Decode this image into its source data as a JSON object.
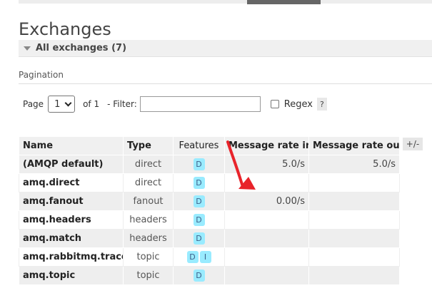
{
  "page": {
    "title": "Exchanges",
    "section_label": "All exchanges (7)"
  },
  "pagination": {
    "label": "Pagination",
    "page_label": "Page",
    "page_value": "1",
    "of_label": "of 1",
    "filter_label": "- Filter:",
    "filter_value": "",
    "regex_label": "Regex",
    "regex_checked": false,
    "help_label": "?"
  },
  "table": {
    "columns": [
      "Name",
      "Type",
      "Features",
      "Message rate in",
      "Message rate out"
    ],
    "plus_minus": "+/-",
    "rows": [
      {
        "name": "(AMQP default)",
        "type": "direct",
        "features": [
          "D"
        ],
        "rate_in": "5.0/s",
        "rate_out": "5.0/s"
      },
      {
        "name": "amq.direct",
        "type": "direct",
        "features": [
          "D"
        ],
        "rate_in": "",
        "rate_out": ""
      },
      {
        "name": "amq.fanout",
        "type": "fanout",
        "features": [
          "D"
        ],
        "rate_in": "0.00/s",
        "rate_out": ""
      },
      {
        "name": "amq.headers",
        "type": "headers",
        "features": [
          "D"
        ],
        "rate_in": "",
        "rate_out": ""
      },
      {
        "name": "amq.match",
        "type": "headers",
        "features": [
          "D"
        ],
        "rate_in": "",
        "rate_out": ""
      },
      {
        "name": "amq.rabbitmq.trace",
        "type": "topic",
        "features": [
          "D",
          "I"
        ],
        "rate_in": "",
        "rate_out": ""
      },
      {
        "name": "amq.topic",
        "type": "topic",
        "features": [
          "D"
        ],
        "rate_in": "",
        "rate_out": ""
      }
    ]
  },
  "colors": {
    "badge_bg": "#99ebff",
    "annotation_arrow": "#e8232a"
  }
}
